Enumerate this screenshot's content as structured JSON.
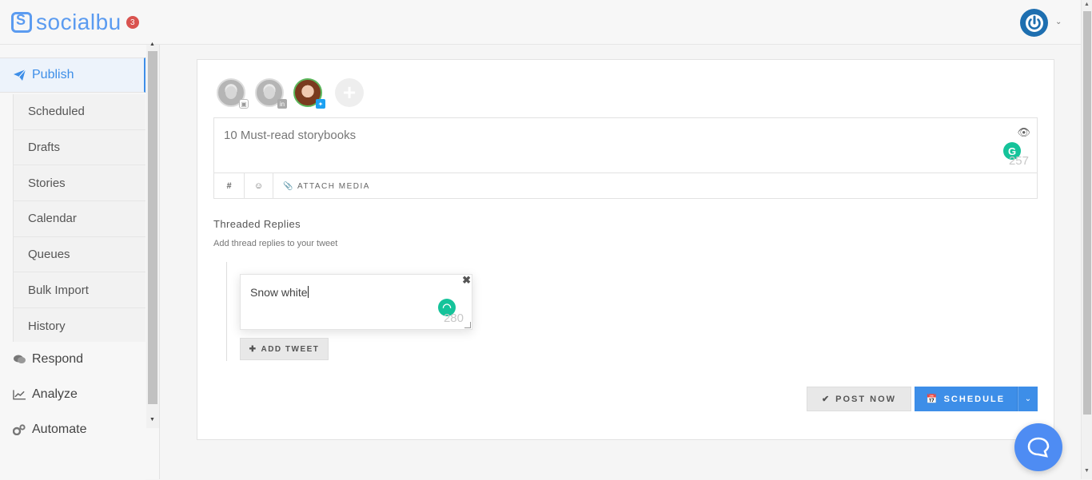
{
  "brand": {
    "name": "socialbu",
    "notification_count": "3",
    "accent": "#3d8ee8"
  },
  "sidebar": {
    "publish": "Publish",
    "sub_items": [
      "Scheduled",
      "Drafts",
      "Stories",
      "Calendar",
      "Queues",
      "Bulk Import",
      "History"
    ],
    "respond": "Respond",
    "analyze": "Analyze",
    "automate": "Automate"
  },
  "composer": {
    "accounts": [
      {
        "network": "instagram",
        "icon": "instagram-icon"
      },
      {
        "network": "linkedin",
        "icon": "linkedin-icon"
      },
      {
        "network": "twitter",
        "icon": "twitter-icon"
      }
    ],
    "text": "10 Must-read storybooks",
    "char_count": "257",
    "toolbar": {
      "hashtag": "#",
      "emoji": "☺",
      "attach": "ATTACH MEDIA"
    }
  },
  "thread": {
    "title": "Threaded Replies",
    "subtitle": "Add thread replies to your tweet",
    "reply_text": "Snow white",
    "reply_count": "280",
    "add_label": "ADD TWEET"
  },
  "actions": {
    "post_now": "POST NOW",
    "schedule": "SCHEDULE"
  }
}
